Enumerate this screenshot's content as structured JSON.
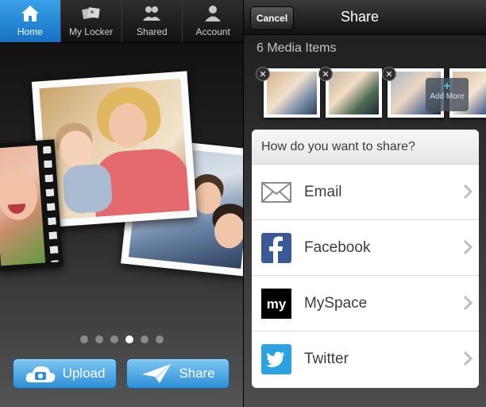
{
  "left": {
    "tabs": [
      {
        "label": "Home",
        "icon": "home-icon",
        "active": true
      },
      {
        "label": "My Locker",
        "icon": "photos-icon",
        "active": false
      },
      {
        "label": "Shared",
        "icon": "people-icon",
        "active": false
      },
      {
        "label": "Account",
        "icon": "person-icon",
        "active": false
      }
    ],
    "pager": {
      "count": 6,
      "active_index": 3
    },
    "buttons": {
      "upload_label": "Upload",
      "share_label": "Share"
    }
  },
  "right": {
    "nav": {
      "cancel_label": "Cancel",
      "title": "Share"
    },
    "media_count_label": "6 Media Items",
    "add_more_label": "Add More",
    "panel": {
      "heading": "How do you want to share?",
      "options": [
        {
          "label": "Email",
          "icon": "email-icon"
        },
        {
          "label": "Facebook",
          "icon": "facebook-icon"
        },
        {
          "label": "MySpace",
          "icon": "myspace-icon"
        },
        {
          "label": "Twitter",
          "icon": "twitter-icon"
        }
      ]
    }
  },
  "colors": {
    "accent": "#2f8fd6",
    "tab_active": "#1672c4",
    "facebook": "#3b5998",
    "twitter": "#2aa3e0",
    "myspace": "#000000"
  }
}
